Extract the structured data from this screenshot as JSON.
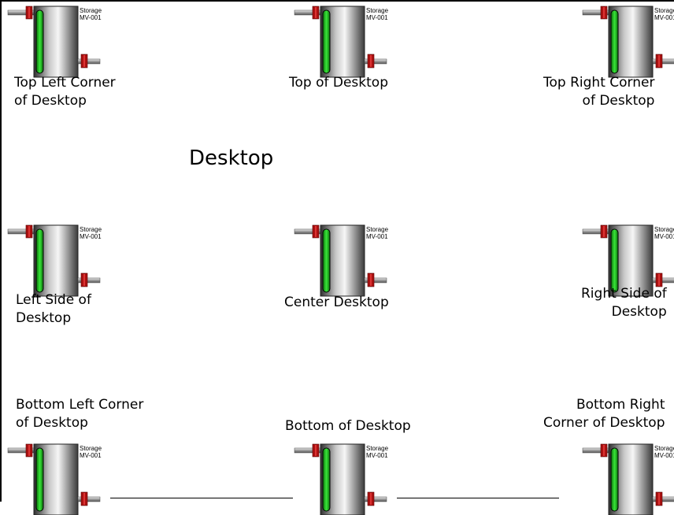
{
  "desktop_title": "Desktop",
  "tank_caption": {
    "line1": "Storage",
    "line2": "MV-001"
  },
  "positions": {
    "top_left": {
      "line1": "Top Left Corner",
      "line2": "of Desktop"
    },
    "top": {
      "line1": "Top of Desktop"
    },
    "top_right": {
      "line1": "Top Right Corner",
      "line2": "of Desktop"
    },
    "left_side": {
      "line1": "Left Side of",
      "line2": "Desktop"
    },
    "center": {
      "line1": "Center Desktop"
    },
    "right_side": {
      "line1": "Right Side of",
      "line2": "Desktop"
    },
    "bottom_left": {
      "line1": "Bottom Left Corner",
      "line2": "of Desktop"
    },
    "bottom": {
      "line1": "Bottom of Desktop"
    },
    "bottom_right": {
      "line1": "Bottom Right",
      "line2": "Corner of Desktop"
    }
  },
  "colors": {
    "level_indicator": "#22cc22",
    "valve": "#aa1111",
    "tank_body_light": "#f4f4f4",
    "tank_body_dark": "#333333",
    "pipe": "#b0b0b0"
  }
}
